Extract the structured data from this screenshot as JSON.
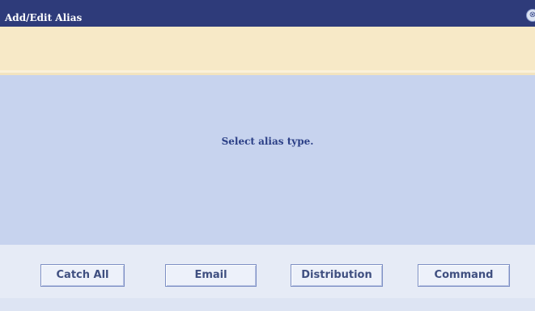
{
  "window": {
    "title": "Add/Edit Alias",
    "close_icon": "close-icon",
    "close_glyph": "⊗"
  },
  "message_bar": {
    "text": ""
  },
  "content": {
    "prompt": "Select alias type."
  },
  "buttons": {
    "catch_all": "Catch All",
    "email": "Email",
    "distribution": "Distribution",
    "command": "Command"
  },
  "colors": {
    "titlebar": "#2e3b7a",
    "message_bar": "#f7e9c7",
    "content_panel": "#c7d3ee",
    "button_panel": "#e6ebf6",
    "prompt_text": "#2b3f86"
  }
}
